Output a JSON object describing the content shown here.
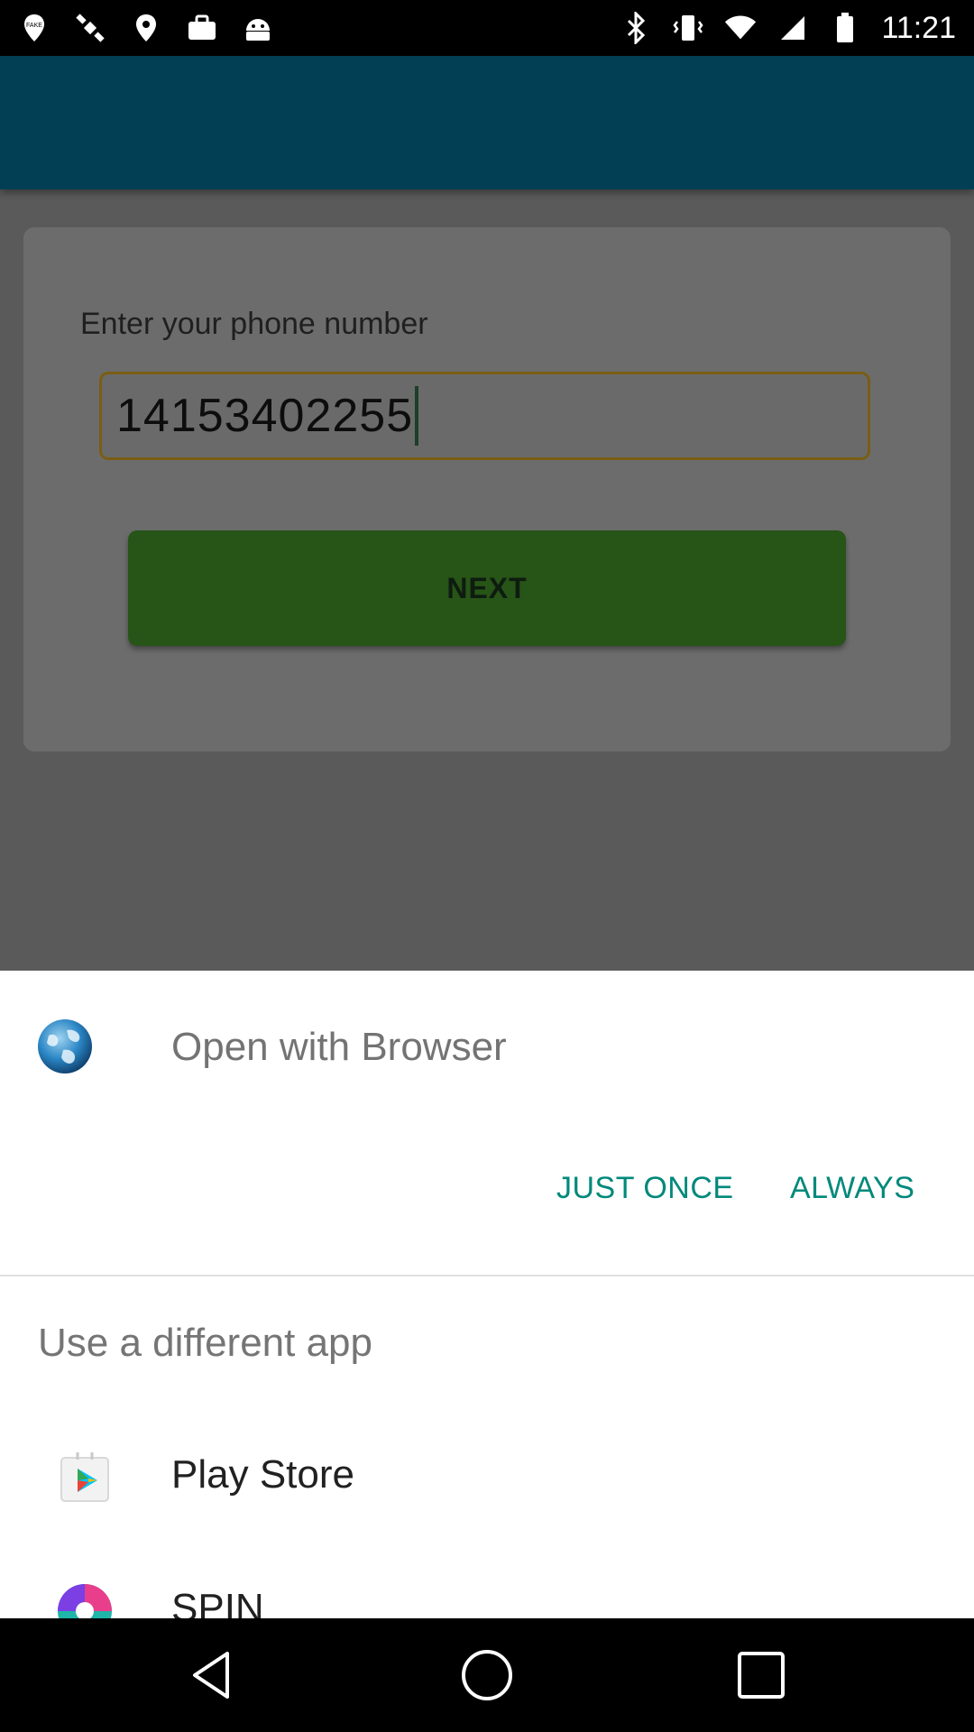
{
  "status_bar": {
    "time": "11:21",
    "left_icons": [
      "fake-gps-icon",
      "satellite-icon",
      "location-icon",
      "briefcase-icon",
      "android-icon"
    ],
    "right_icons": [
      "bluetooth-icon",
      "vibrate-icon",
      "wifi-icon",
      "signal-icon",
      "battery-icon"
    ]
  },
  "login_card": {
    "prompt": "Enter your phone number",
    "phone_value": "14153402255",
    "next_label": "NEXT"
  },
  "sheet": {
    "title": "Open with Browser",
    "just_once_label": "JUST ONCE",
    "always_label": "ALWAYS",
    "different_app_label": "Use a different app",
    "apps": [
      {
        "label": "Play Store",
        "icon": "play-store-icon"
      },
      {
        "label": "SPIN",
        "icon": "spin-icon"
      }
    ]
  },
  "nav_bar": {
    "icons": [
      "back-icon",
      "home-icon",
      "recents-icon"
    ]
  },
  "colors": {
    "accent": "#00897b",
    "app_header": "#023f55",
    "next_button": "#275417",
    "field_border": "#7a5e14"
  }
}
